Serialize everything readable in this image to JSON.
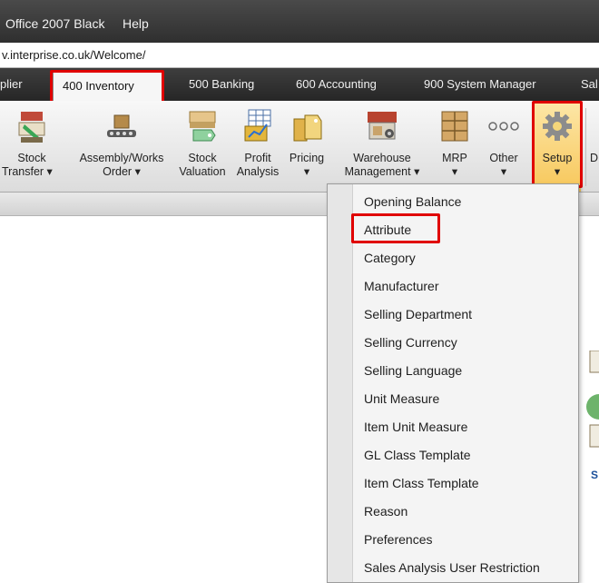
{
  "menubar": {
    "theme_label": "Office 2007 Black",
    "help_label": "Help"
  },
  "address": {
    "url": "v.interprise.co.uk/Welcome/"
  },
  "tabs": [
    {
      "label": "plier"
    },
    {
      "label": "400 Inventory"
    },
    {
      "label": "500 Banking"
    },
    {
      "label": "600 Accounting"
    },
    {
      "label": "900 System Manager"
    },
    {
      "label": "Sal"
    }
  ],
  "ribbon": {
    "stock_transfer": {
      "line1": "Stock",
      "line2": "Transfer ▾"
    },
    "assembly": {
      "line1": "Assembly/Works",
      "line2": "Order ▾"
    },
    "stock_valuation": {
      "line1": "Stock",
      "line2": "Valuation"
    },
    "profit_analysis": {
      "line1": "Profit",
      "line2": "Analysis"
    },
    "pricing": {
      "line1": "Pricing",
      "line2": "▾"
    },
    "warehouse": {
      "line1": "Warehouse",
      "line2": "Management ▾"
    },
    "mrp": {
      "line1": "MRP",
      "line2": "▾"
    },
    "other": {
      "line1": "Other",
      "line2": "▾"
    },
    "setup": {
      "line1": "Setup",
      "line2": "▾"
    },
    "next_partial": {
      "line1": "D"
    }
  },
  "setup_menu": {
    "items": [
      "Opening Balance",
      "Attribute",
      "Category",
      "Manufacturer",
      "Selling Department",
      "Selling Currency",
      "Selling Language",
      "Unit Measure",
      "Item Unit Measure",
      "GL Class Template",
      "Item Class Template",
      "Reason",
      "Preferences",
      "Sales Analysis User Restriction"
    ]
  },
  "content": {
    "edge_text": "S"
  },
  "colors": {
    "highlight": "#e00000",
    "menubar_bg": "#2f2f2f",
    "ribbon_bg": "#e8e8e8"
  }
}
